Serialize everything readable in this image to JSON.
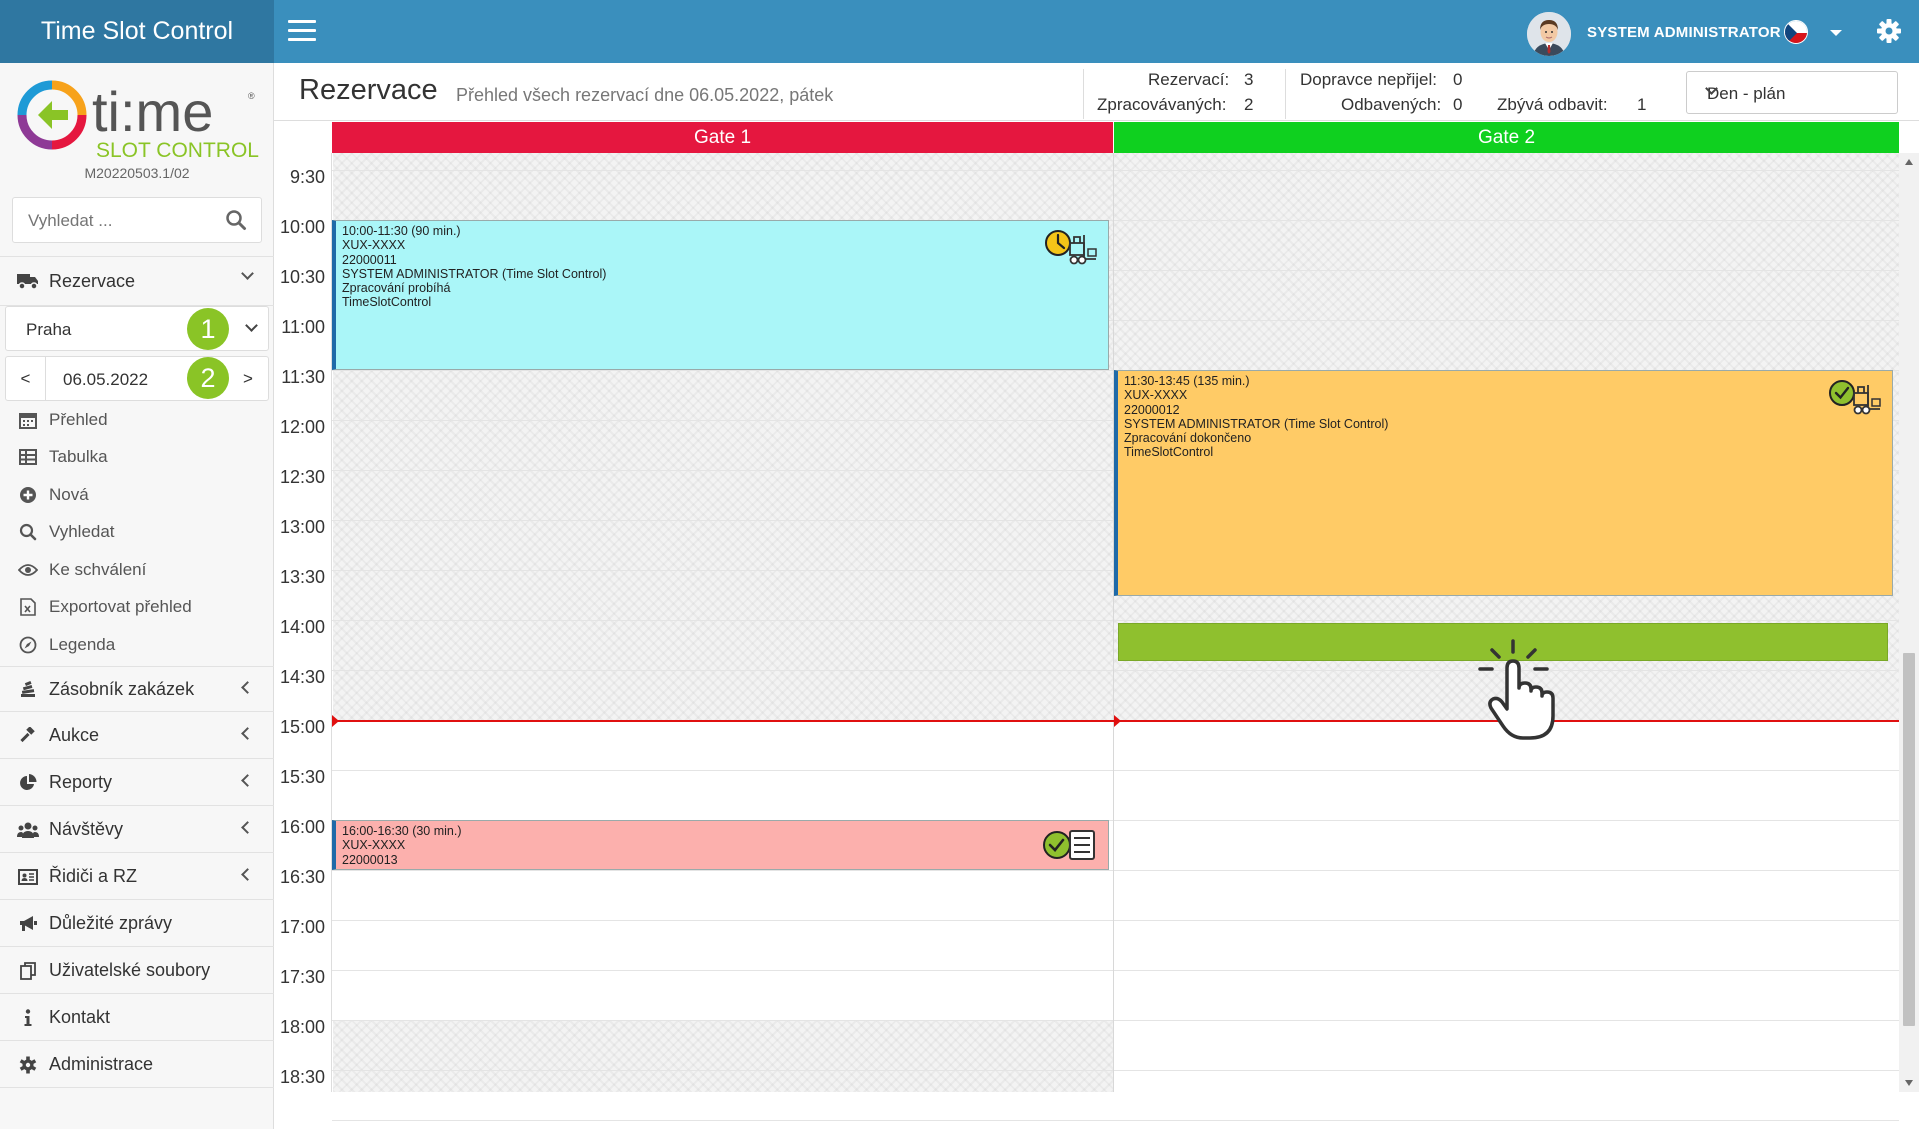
{
  "app": {
    "title": "Time Slot Control",
    "version": "M20220503.1/02"
  },
  "logo": {
    "word": "ti:me",
    "tagline": "SLOT CONTROL"
  },
  "user": {
    "name": "SYSTEM ADMINISTRATOR"
  },
  "search": {
    "placeholder": "Vyhledat ..."
  },
  "sidebar": {
    "reservations_label": "Rezervace",
    "branch": "Praha",
    "date": "06.05.2022",
    "date_prev": "<",
    "date_next": ">",
    "badges": [
      "1",
      "2"
    ],
    "items": [
      {
        "label": "Přehled",
        "icon": "calendar-icon"
      },
      {
        "label": "Tabulka",
        "icon": "table-icon"
      },
      {
        "label": "Nová",
        "icon": "plus-circle-icon"
      },
      {
        "label": "Vyhledat",
        "icon": "search-icon"
      },
      {
        "label": "Ke schválení",
        "icon": "eye-icon"
      },
      {
        "label": "Exportovat přehled",
        "icon": "excel-file-icon"
      },
      {
        "label": "Legenda",
        "icon": "compass-icon"
      }
    ],
    "sections": [
      {
        "label": "Zásobník zakázek",
        "icon": "stack-icon"
      },
      {
        "label": "Aukce",
        "icon": "gavel-icon"
      },
      {
        "label": "Reporty",
        "icon": "pie-chart-icon"
      },
      {
        "label": "Návštěvy",
        "icon": "users-icon"
      },
      {
        "label": "Řidiči a RZ",
        "icon": "id-card-icon"
      },
      {
        "label": "Důležité zprávy",
        "icon": "megaphone-icon"
      },
      {
        "label": "Uživatelské soubory",
        "icon": "files-icon"
      },
      {
        "label": "Kontakt",
        "icon": "info-icon"
      },
      {
        "label": "Administrace",
        "icon": "gear-icon"
      }
    ]
  },
  "header": {
    "title": "Rezervace",
    "subtitle": "Přehled všech rezervací dne 06.05.2022, pátek",
    "stats": {
      "rezervaci_label": "Rezervací:",
      "rezervaci": "3",
      "zpracovavanych_label": "Zpracovávaných:",
      "zpracovavanych": "2",
      "neprijel_label": "Dopravce nepřijel:",
      "neprijel": "0",
      "odbavenych_label": "Odbavených:",
      "odbavenych": "0",
      "zbyva_label": "Zbývá odbavit:",
      "zbyva": "1"
    },
    "view": "Den - plán"
  },
  "calendar": {
    "gates": [
      {
        "name": "Gate 1",
        "color": "#e5173f"
      },
      {
        "name": "Gate 2",
        "color": "#0fd01f"
      }
    ],
    "times": [
      "9:30",
      "10:00",
      "10:30",
      "11:00",
      "11:30",
      "12:00",
      "12:30",
      "13:00",
      "13:30",
      "14:00",
      "14:30",
      "15:00",
      "15:30",
      "16:00",
      "16:30",
      "17:00",
      "17:30",
      "18:00",
      "18:30"
    ],
    "reservations": [
      {
        "gate": 1,
        "lines": [
          "10:00-11:30 (90 min.)",
          "XUX-XXXX",
          "22000011",
          "SYSTEM ADMINISTRATOR (Time Slot Control)",
          "Zpracování probíhá",
          "TimeSlotControl"
        ],
        "color": "#aaf6f8",
        "icon": "clock-forklift-icon"
      },
      {
        "gate": 2,
        "lines": [
          "11:30-13:45 (135 min.)",
          "XUX-XXXX",
          "22000012",
          "SYSTEM ADMINISTRATOR (Time Slot Control)",
          "Zpracování dokončeno",
          "TimeSlotControl"
        ],
        "color": "#ffcb66",
        "icon": "check-forklift-icon"
      },
      {
        "gate": 1,
        "lines": [
          "16:00-16:30 (30 min.)",
          "XUX-XXXX",
          "22000013"
        ],
        "color": "#fcb0ad",
        "icon": "check-list-icon"
      }
    ]
  }
}
